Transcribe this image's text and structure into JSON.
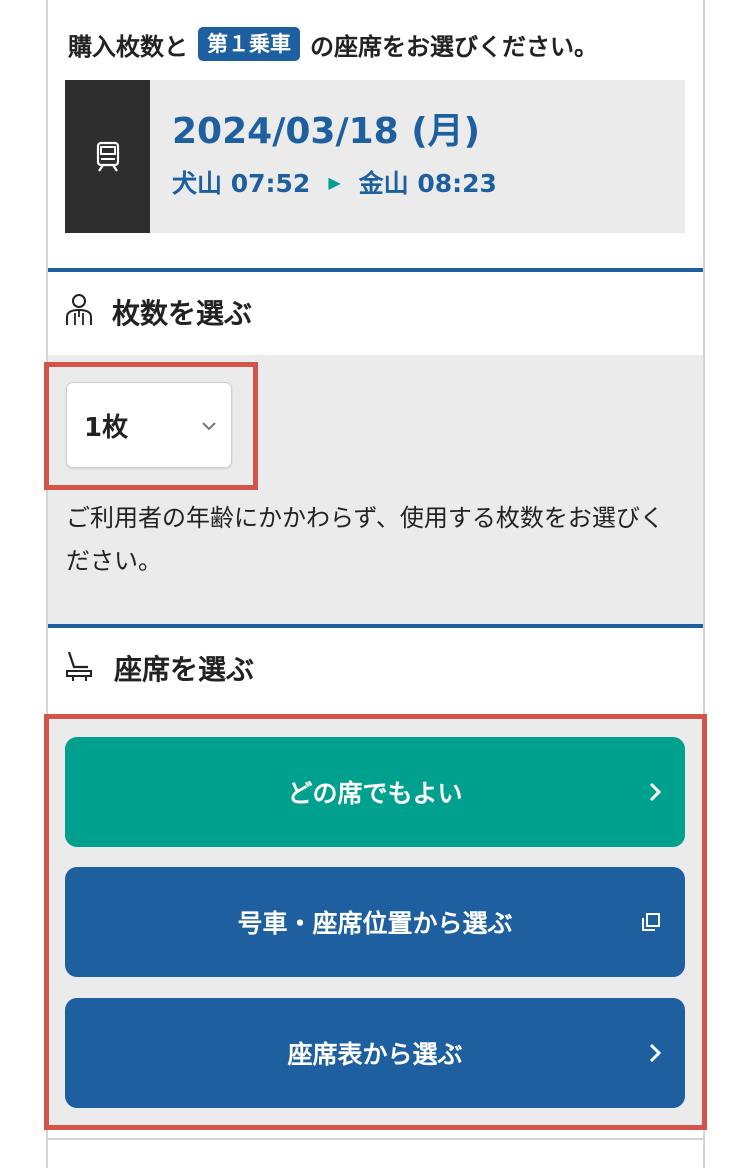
{
  "header": {
    "instruction_before": "購入枚数と",
    "car_badge": "第１乗車",
    "instruction_after": "の座席をお選びください。"
  },
  "train": {
    "icon": "train-icon",
    "date": "2024/03/18 (月)",
    "from_station": "犬山",
    "from_time": "07:52",
    "to_station": "金山",
    "to_time": "08:23",
    "arrow": "▶"
  },
  "quantity_section": {
    "title": "枚数を選ぶ",
    "icon": "person-icon",
    "selected": "1枚",
    "note": "ご利用者の年齢にかかわらず、使用する枚数をお選びください。"
  },
  "seat_section": {
    "title": "座席を選ぶ",
    "icon": "seat-icon",
    "buttons": [
      {
        "label": "どの席でもよい",
        "icon": "chevron-right-icon"
      },
      {
        "label": "号車・座席位置から選ぶ",
        "icon": "external-window-icon"
      },
      {
        "label": "座席表から選ぶ",
        "icon": "chevron-right-icon"
      }
    ]
  },
  "colors": {
    "brand_blue": "#1e5fa0",
    "accent_green": "#00a08e",
    "highlight_red": "#d2544a"
  }
}
